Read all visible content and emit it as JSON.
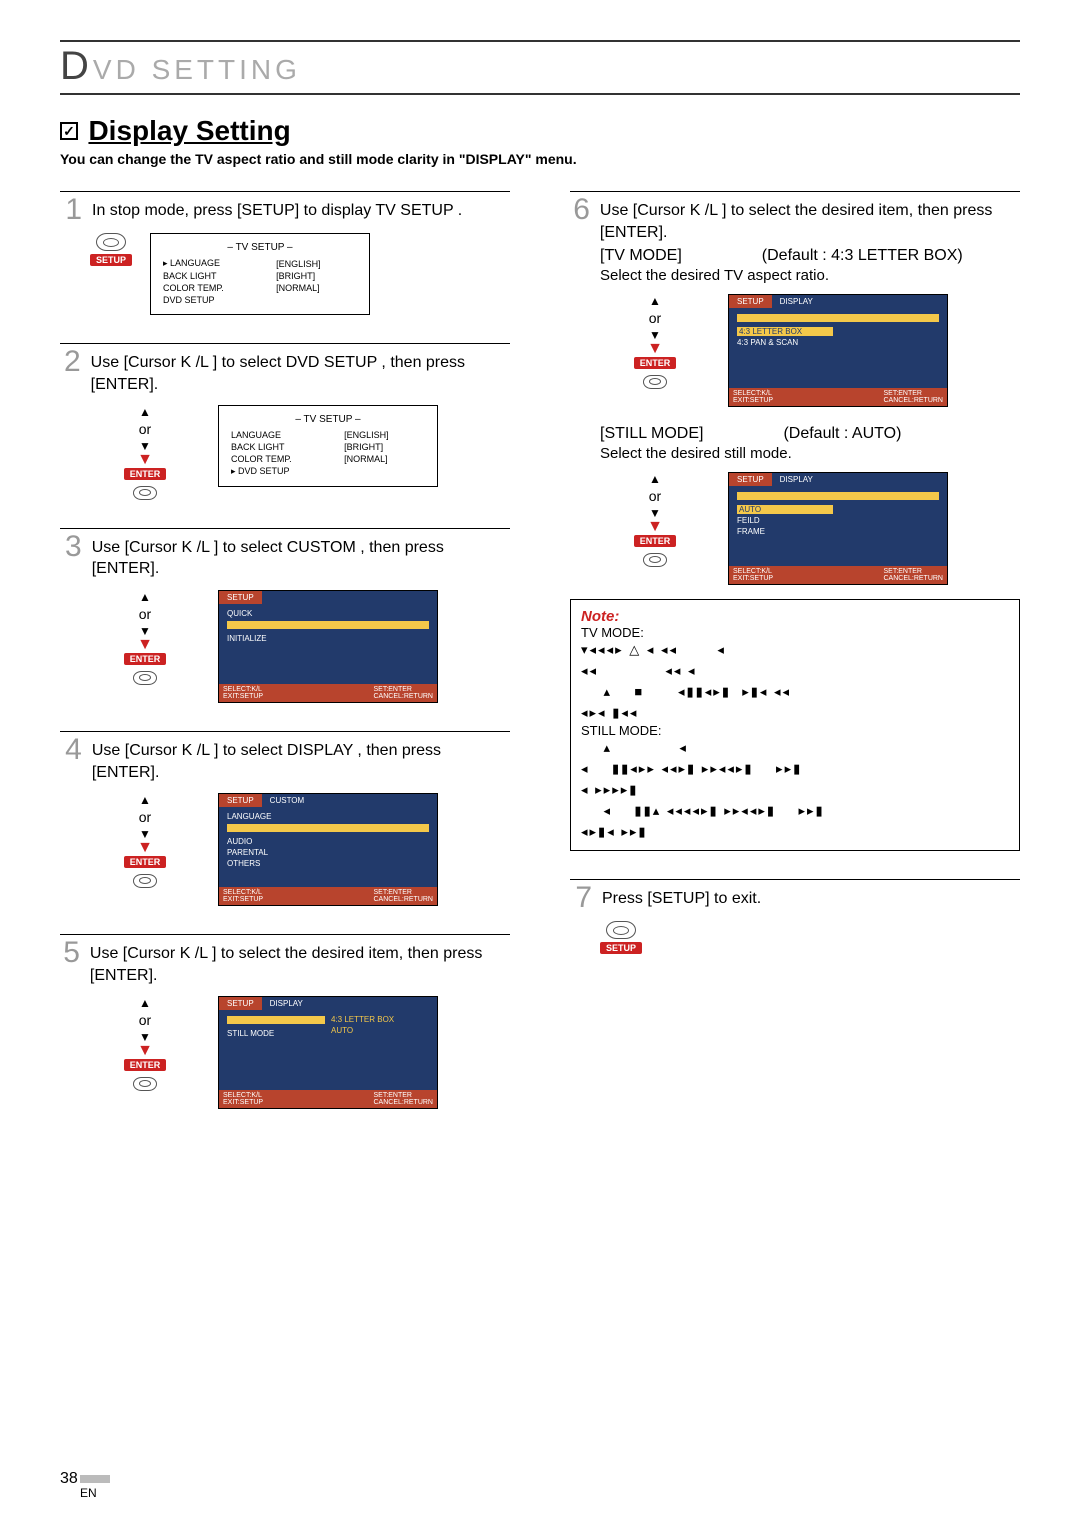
{
  "header": {
    "title": "VD  SETTING",
    "big_d": "D"
  },
  "section": {
    "title": "Display Setting",
    "subtitle": "You can change the TV aspect ratio and still mode clarity in \"DISPLAY\" menu."
  },
  "labels": {
    "or": "or",
    "enter": "ENTER",
    "setup": "SETUP"
  },
  "steps": [
    {
      "num": "1",
      "text": "In stop mode, press [SETUP] to display  TV SETUP ."
    },
    {
      "num": "2",
      "text": "Use [Cursor K /L ] to select  DVD SETUP , then press [ENTER]."
    },
    {
      "num": "3",
      "text": "Use [Cursor K /L ] to select  CUSTOM , then press [ENTER]."
    },
    {
      "num": "4",
      "text": "Use [Cursor K /L ] to select  DISPLAY , then press [ENTER]."
    },
    {
      "num": "5",
      "text": "Use [Cursor K /L ] to select the desired item, then press [ENTER]."
    },
    {
      "num": "6",
      "text": "Use [Cursor K /L ] to select the desired item, then press [ENTER]."
    },
    {
      "num": "7",
      "text": "Press [SETUP] to exit."
    }
  ],
  "tv_setup": {
    "title": "–  TV SETUP  –",
    "rows": [
      [
        "LANGUAGE",
        "[ENGLISH]"
      ],
      [
        "BACK LIGHT",
        "[BRIGHT]"
      ],
      [
        "COLOR TEMP.",
        "[NORMAL]"
      ],
      [
        "DVD SETUP",
        ""
      ]
    ]
  },
  "osd_footer": {
    "left": "SELECT:K/L\nEXIT:SETUP",
    "right": "SET:ENTER\nCANCEL:RETURN"
  },
  "osd3": {
    "tab_on": "SETUP",
    "items": [
      "QUICK",
      "",
      "INITIALIZE"
    ]
  },
  "osd4": {
    "tab_on": "SETUP",
    "tab_off": "CUSTOM",
    "items": [
      "LANGUAGE",
      "",
      "AUDIO",
      "PARENTAL",
      "OTHERS"
    ]
  },
  "osd5": {
    "tab_on": "SETUP",
    "tab_off": "DISPLAY",
    "left_items": [
      "",
      "STILL MODE"
    ],
    "right_items": [
      "4:3 LETTER BOX",
      "AUTO"
    ]
  },
  "step6a": {
    "heading": "[TV MODE]",
    "default": "(Default : 4:3 LETTER BOX)",
    "desc": "Select the desired TV aspect ratio.",
    "osd": {
      "tab_on": "SETUP",
      "tab_off": "DISPLAY",
      "items": [
        "4:3 LETTER BOX",
        "4:3 PAN & SCAN"
      ]
    }
  },
  "step6b": {
    "heading": "[STILL MODE]",
    "default": "(Default : AUTO)",
    "desc": "Select the desired still mode.",
    "osd": {
      "tab_on": "SETUP",
      "tab_off": "DISPLAY",
      "items": [
        "AUTO",
        "FEILD",
        "FRAME"
      ]
    }
  },
  "note": {
    "title": "Note:",
    "tv_label": "TV MODE:",
    "still_label": "STILL MODE:"
  },
  "page": {
    "num": "38",
    "lang": "EN"
  }
}
